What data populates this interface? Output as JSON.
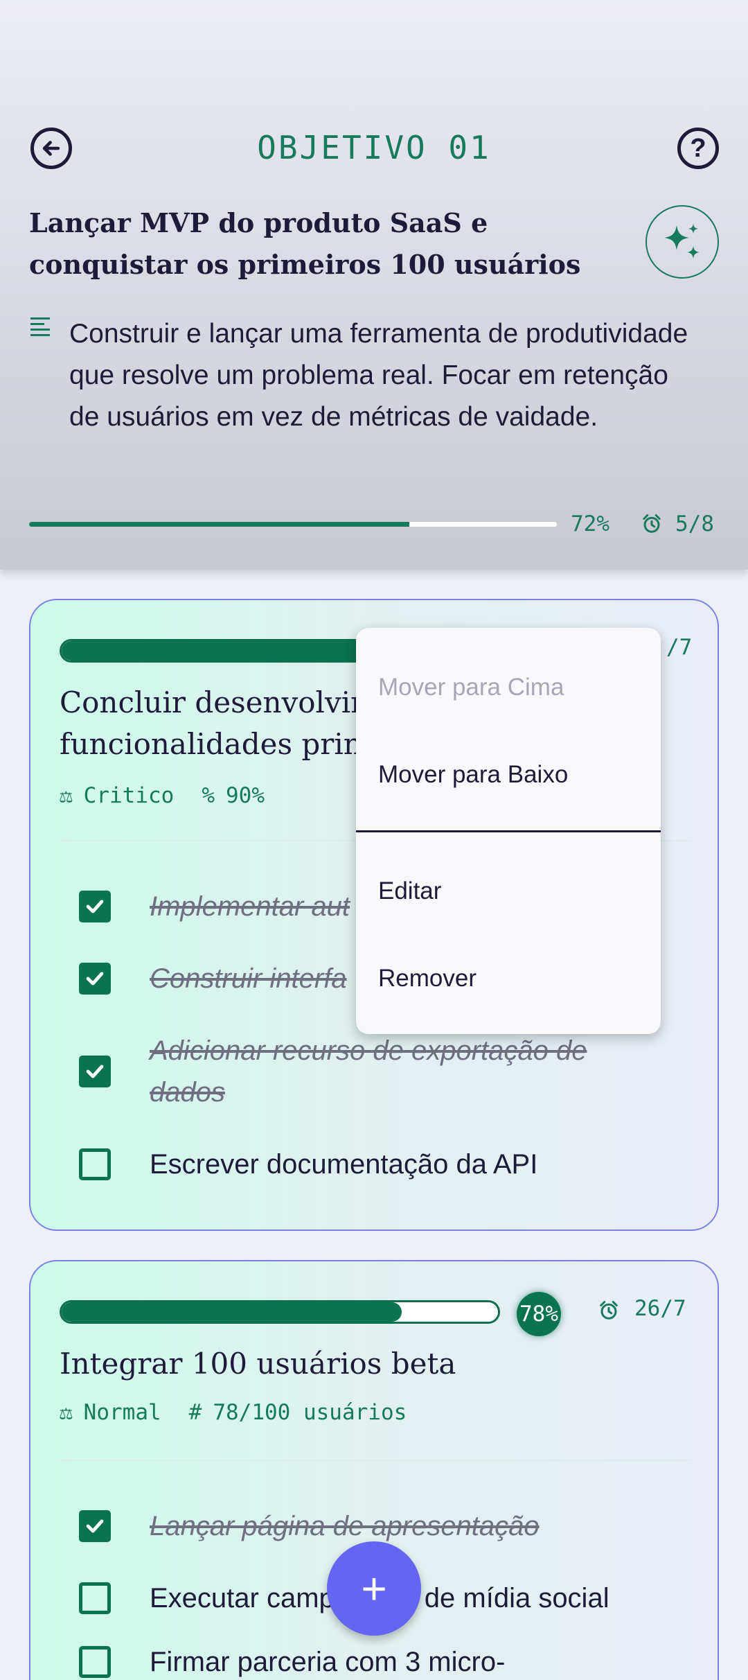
{
  "header": {
    "objective_label": "OBJETIVO 01",
    "title": "Lançar MVP do produto SaaS e conquistar os primeiros 100 usuários",
    "description": "Construir e lançar uma ferramenta de produtividade que resolve um problema real. Focar em retenção de usuários em vez de métricas de vaidade.",
    "progress_percent": 72,
    "progress_label": "72%",
    "count_label": "5/8",
    "icons": [
      "back-arrow-icon",
      "help-icon",
      "sparkle-icon",
      "description-lines-icon",
      "alarm-icon"
    ]
  },
  "key_results": [
    {
      "title": "Concluir desenvolvimento das funcionalidades principais",
      "title_visible_lines": [
        "Concluir desenvolvim",
        "funcionalidades princ"
      ],
      "priority": "Critico",
      "metric_symbol": "%",
      "metric": "90%",
      "count": "/7",
      "tasks": [
        {
          "text": "Implementar autenticação",
          "text_visible": "Implementar aut",
          "done": true
        },
        {
          "text": "Construir interface",
          "text_visible": "Construir interfa",
          "done": true
        },
        {
          "text": "Adicionar recurso de exportação de dados",
          "done": true
        },
        {
          "text": "Escrever documentação da API",
          "done": false
        }
      ]
    },
    {
      "title": "Integrar 100 usuários beta",
      "progress_percent": 78,
      "badge": "78%",
      "count": "26/7",
      "priority": "Normal",
      "metric_symbol": "#",
      "metric": "78/100 usuários",
      "tasks": [
        {
          "text": "Lançar página de apresentação",
          "done": true
        },
        {
          "text_left": "Executar camp",
          "text_right": "de mídia social",
          "done": false
        },
        {
          "text": "Firmar parceria com 3 micro-",
          "done": false
        }
      ]
    }
  ],
  "context_menu": {
    "items": [
      {
        "label": "Mover para Cima",
        "enabled": false
      },
      {
        "label": "Mover para Baixo",
        "enabled": true
      },
      {
        "label": "Editar",
        "enabled": true
      },
      {
        "label": "Remover",
        "enabled": true
      }
    ]
  },
  "fab": {
    "label": "+"
  },
  "colors": {
    "accent": "#167a5b",
    "fab": "#6466f1",
    "card_border": "#7d7fe8",
    "text": "#1e1b3a"
  }
}
